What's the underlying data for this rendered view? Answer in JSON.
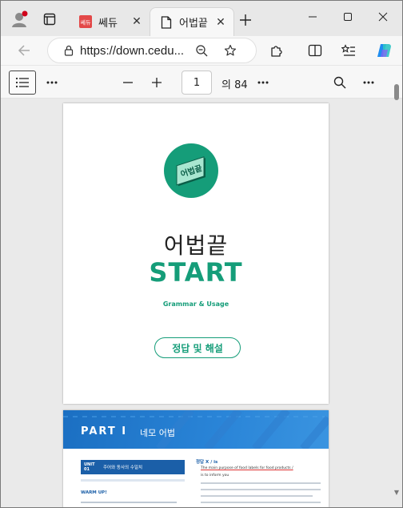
{
  "browser": {
    "tabs": [
      {
        "label": "쎄듀",
        "favicon": "cedu-logo"
      },
      {
        "label": "어법끝",
        "favicon": "page-icon"
      }
    ],
    "address": {
      "url": "https://down.cedu..."
    }
  },
  "pdf_toolbar": {
    "page_current": "1",
    "page_total": "의 84"
  },
  "page1": {
    "logo_text": "어법끝",
    "title": "어법끝",
    "subtitle": "START",
    "tagline": "Grammar & Usage",
    "badge": "정답 및 해설"
  },
  "page2": {
    "part_label": "PART I",
    "part_title": "네모 어법",
    "unit_label": "UNIT 01",
    "unit_title": "주어와 동사의 수일치",
    "section_label": "WARM UP!",
    "answer_tag": "정답 X / is",
    "line1": "The main purpose of food labels for food products /",
    "line2": "is to inform you"
  },
  "colors": {
    "brand_green": "#159d79",
    "part_blue": "#1b6fc2"
  }
}
